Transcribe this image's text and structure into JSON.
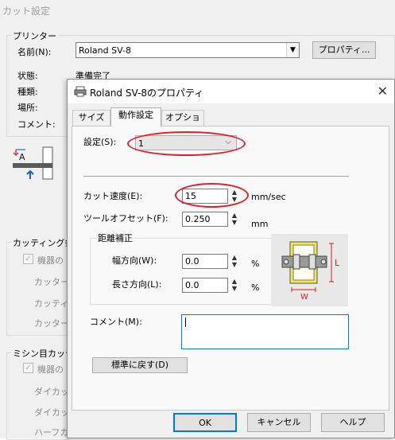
{
  "parent": {
    "title": "カット設定",
    "printer_group": "プリンター",
    "name_label": "名前(N):",
    "printer_name": "Roland SV-8",
    "properties_button": "プロパティ...",
    "status_label": "状態:",
    "status_value": "準備完了",
    "type_label": "種類:",
    "location_label": "場所:",
    "comment_label": "コメント:",
    "cutting_group": "カッティング条件",
    "cutting_checkbox_label": "機器の",
    "cutter_pressure": "カッター圧",
    "cutting_speed_trunc": "カッティン",
    "cutter_offset_trunc": "カッターオ",
    "perforation_group": "ミシン目カッティ",
    "perf_checkbox_label": "機器の",
    "die_cut_1": "ダイカット",
    "die_cut_2": "ダイカット",
    "half_cut": "ハーフカッ"
  },
  "dialog": {
    "title": "Roland SV-8のプロパティ",
    "tabs": [
      "サイズ",
      "動作設定",
      "オプション"
    ],
    "setting_label": "設定(S):",
    "setting_value": "1",
    "cut_speed_label": "カット速度(E):",
    "cut_speed_value": "15",
    "cut_speed_unit": "mm/sec",
    "tool_offset_label": "ツールオフセット(F):",
    "tool_offset_value": "0.250",
    "tool_offset_unit": "mm",
    "distance_group": "距離補正",
    "width_label": "幅方向(W):",
    "width_value": "0.0",
    "width_unit": "%",
    "length_label": "長さ方向(L):",
    "length_value": "0.0",
    "length_unit": "%",
    "diagram_l": "L",
    "diagram_w": "W",
    "comment_label": "コメント(M):",
    "comment_value": "",
    "reset_button": "標準に戻す(D)",
    "ok_button": "OK",
    "cancel_button": "キャンセル",
    "help_button": "ヘルプ"
  },
  "colors": {
    "highlight": "#e0202a",
    "accent": "#0078d7",
    "diagram_yellow": "#f4e84a"
  }
}
